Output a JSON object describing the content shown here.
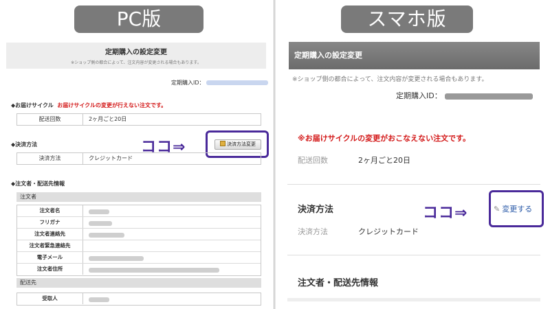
{
  "pc": {
    "label": "PC版",
    "header": {
      "title": "定期購入の設定変更",
      "note": "※ショップ側の都合によって、注文内容が変更される場合もあります。"
    },
    "order_id_label": "定期購入ID：",
    "cycle": {
      "title": "◆お届けサイクル",
      "warning": "お届けサイクルの変更が行えない注文です。",
      "row_label": "配送回数",
      "row_value": "2ヶ月ごと20日"
    },
    "payment": {
      "title": "◆決済方法",
      "button": "決済方法変更",
      "row_label": "決済方法",
      "row_value": "クレジットカード"
    },
    "arrow": "ココ⇒",
    "customer": {
      "title": "◆注文者・配送先情報",
      "subheader": "注文者",
      "rows": [
        {
          "label": "注文者名"
        },
        {
          "label": "フリガナ"
        },
        {
          "label": "注文者連絡先"
        },
        {
          "label": "注文者緊急連絡先"
        },
        {
          "label": "電子メール"
        },
        {
          "label": "注文者住所"
        }
      ]
    },
    "shipping": {
      "subheader": "配送先",
      "rows": [
        {
          "label": "受取人"
        }
      ]
    }
  },
  "sp": {
    "label": "スマホ版",
    "header": {
      "title": "定期購入の設定変更"
    },
    "note": "※ショップ側の都合によって、注文内容が変更される場合もあります。",
    "order_id_label": "定期購入ID：",
    "warning": "※お届けサイクルの変更がおこなえない注文です。",
    "cycle": {
      "label": "配送回数",
      "value": "2ヶ月ごと20日"
    },
    "payment": {
      "title": "決済方法",
      "change": "変更する",
      "label": "決済方法",
      "value": "クレジットカード"
    },
    "arrow": "ココ⇒",
    "customer_title": "注文者・配送先情報"
  },
  "colors": {
    "highlight": "#4a2a9a",
    "warning": "#d31919",
    "link": "#2a5aa8"
  }
}
